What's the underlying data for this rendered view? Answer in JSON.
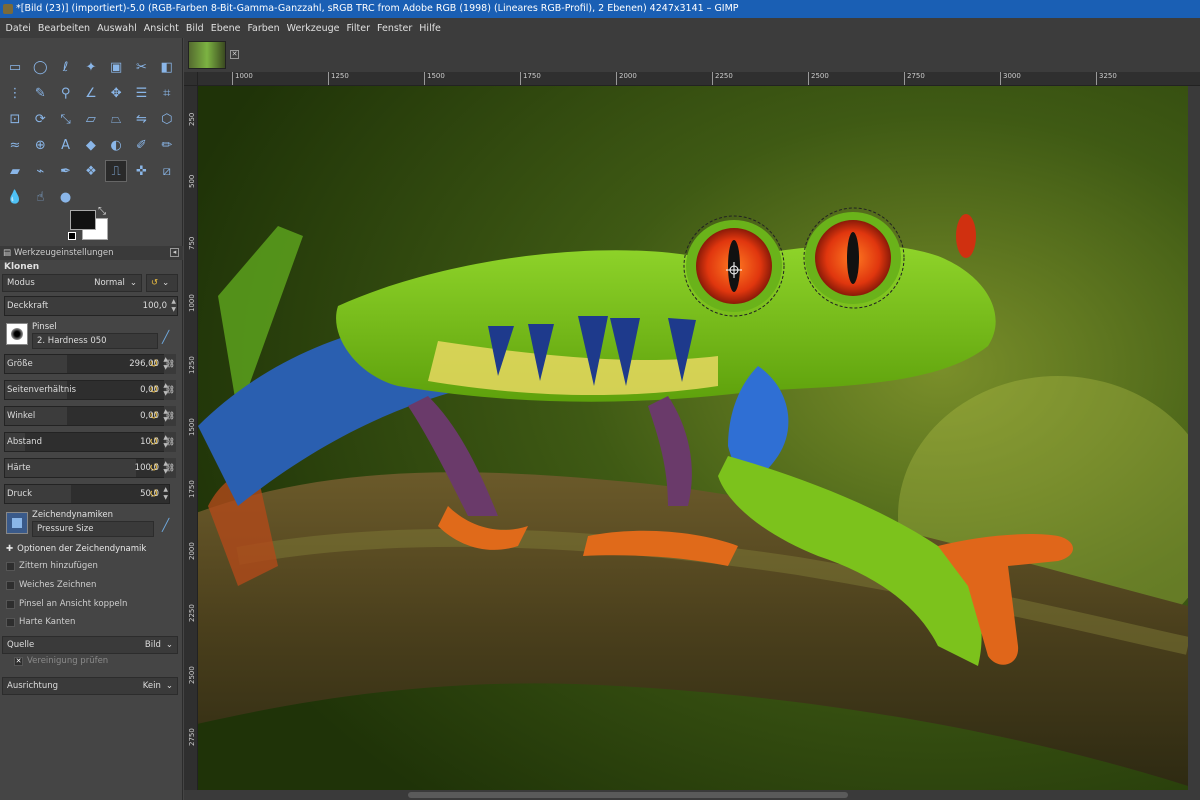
{
  "window": {
    "title": "*[Bild (23)] (importiert)-5.0 (RGB-Farben 8-Bit-Gamma-Ganzzahl, sRGB TRC from Adobe RGB (1998) (Lineares RGB-Profil), 2 Ebenen) 4247x3141 – GIMP"
  },
  "menu": [
    "Datei",
    "Bearbeiten",
    "Auswahl",
    "Ansicht",
    "Bild",
    "Ebene",
    "Farben",
    "Werkzeuge",
    "Filter",
    "Fenster",
    "Hilfe"
  ],
  "toolbox": {
    "tools": [
      "rect-select-icon",
      "ellipse-select-icon",
      "free-select-icon",
      "fuzzy-select-icon",
      "by-color-select-icon",
      "scissors-icon",
      "foreground-select-icon",
      "paths-icon",
      "color-picker-icon",
      "zoom-icon",
      "measure-icon",
      "move-icon",
      "align-icon",
      "crop-icon",
      "unified-transform-icon",
      "rotate-icon",
      "scale-icon",
      "shear-icon",
      "perspective-icon",
      "flip-icon",
      "cage-icon",
      "warp-icon",
      "handle-transform-icon",
      "text-icon",
      "bucket-fill-icon",
      "gradient-icon",
      "paintbrush-icon",
      "pencil-icon",
      "eraser-icon",
      "airbrush-icon",
      "ink-icon",
      "mypaint-icon",
      "clone-icon",
      "heal-icon",
      "perspective-clone-icon",
      "blur-icon",
      "smudge-icon",
      "dodge-burn-icon"
    ],
    "active_tool": "clone-icon",
    "foreground_color": "#111111",
    "background_color": "#ffffff"
  },
  "tool_options": {
    "panel_title": "Werkzeugeinstellungen",
    "tool_name": "Klonen",
    "mode_label": "Modus",
    "mode_value": "Normal",
    "opacity_label": "Deckkraft",
    "opacity_value": "100,0",
    "brush_label": "Pinsel",
    "brush_name": "2. Hardness 050",
    "size_label": "Größe",
    "size_value": "296,00",
    "aspect_label": "Seitenverhältnis",
    "aspect_value": "0,00",
    "angle_label": "Winkel",
    "angle_value": "0,00",
    "spacing_label": "Abstand",
    "spacing_value": "10,0",
    "hardness_label": "Härte",
    "hardness_value": "100,0",
    "force_label": "Druck",
    "force_value": "50,0",
    "dynamics_label": "Zeichendynamiken",
    "dynamics_value": "Pressure Size",
    "dynamics_options_label": "Optionen der Zeichendynamik",
    "jitter_label": "Zittern hinzufügen",
    "smooth_label": "Weiches Zeichnen",
    "lock_brush_label": "Pinsel an Ansicht koppeln",
    "hard_edge_label": "Harte Kanten",
    "source_label": "Quelle",
    "source_value": "Bild",
    "sample_merged_label": "Vereinigung prüfen",
    "alignment_label": "Ausrichtung",
    "alignment_value": "Kein"
  },
  "ruler": {
    "labels": [
      "1000",
      "1250",
      "1500",
      "1750",
      "2000",
      "2250",
      "2500",
      "2750",
      "3000",
      "3250"
    ]
  },
  "vruler_labels": [
    "250",
    "500",
    "750",
    "1000",
    "1250",
    "1500",
    "1750",
    "2000",
    "2250",
    "2500",
    "2750"
  ]
}
